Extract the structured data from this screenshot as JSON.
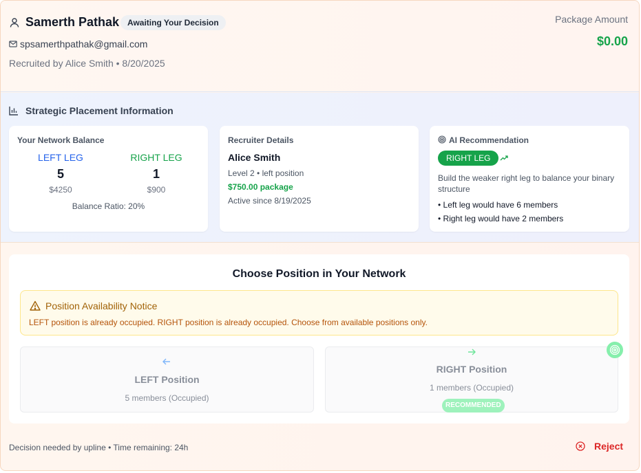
{
  "header": {
    "name": "Samerth Pathak",
    "status": "Awaiting Your Decision",
    "email": "spsamerthpathak@gmail.com",
    "recruited": "Recruited by Alice Smith • 8/20/2025",
    "package_label": "Package Amount",
    "package_amount": "$0.00"
  },
  "strategic": {
    "title": "Strategic Placement Information",
    "balance": {
      "title": "Your Network Balance",
      "left_label": "LEFT LEG",
      "left_count": "5",
      "left_amount": "$4250",
      "right_label": "RIGHT LEG",
      "right_count": "1",
      "right_amount": "$900",
      "ratio": "Balance Ratio: 20%"
    },
    "recruiter": {
      "title": "Recruiter Details",
      "name": "Alice Smith",
      "level": "Level 2 • left position",
      "package": "$750.00 package",
      "active": "Active since 8/19/2025"
    },
    "ai": {
      "title": "AI Recommendation",
      "badge": "RIGHT LEG",
      "description": "Build the weaker right leg to balance your binary structure",
      "bullet1": "• Left leg would have 6 members",
      "bullet2": "• Right leg would have 2 members"
    }
  },
  "choose": {
    "title": "Choose Position in Your Network",
    "notice_title": "Position Availability Notice",
    "notice_message": "LEFT position is already occupied. RIGHT position is already occupied. Choose from available positions only.",
    "left": {
      "title": "LEFT Position",
      "sub": "5 members (Occupied)"
    },
    "right": {
      "title": "RIGHT Position",
      "sub": "1 members (Occupied)",
      "pill": "RECOMMENDED"
    }
  },
  "footer": {
    "text": "Decision needed by upline • Time remaining: 24h",
    "reject_label": "Reject"
  },
  "colors": {
    "accent_green": "#16a34a",
    "accent_blue": "#2563eb",
    "danger": "#dc2626",
    "warning": "#b45309"
  }
}
